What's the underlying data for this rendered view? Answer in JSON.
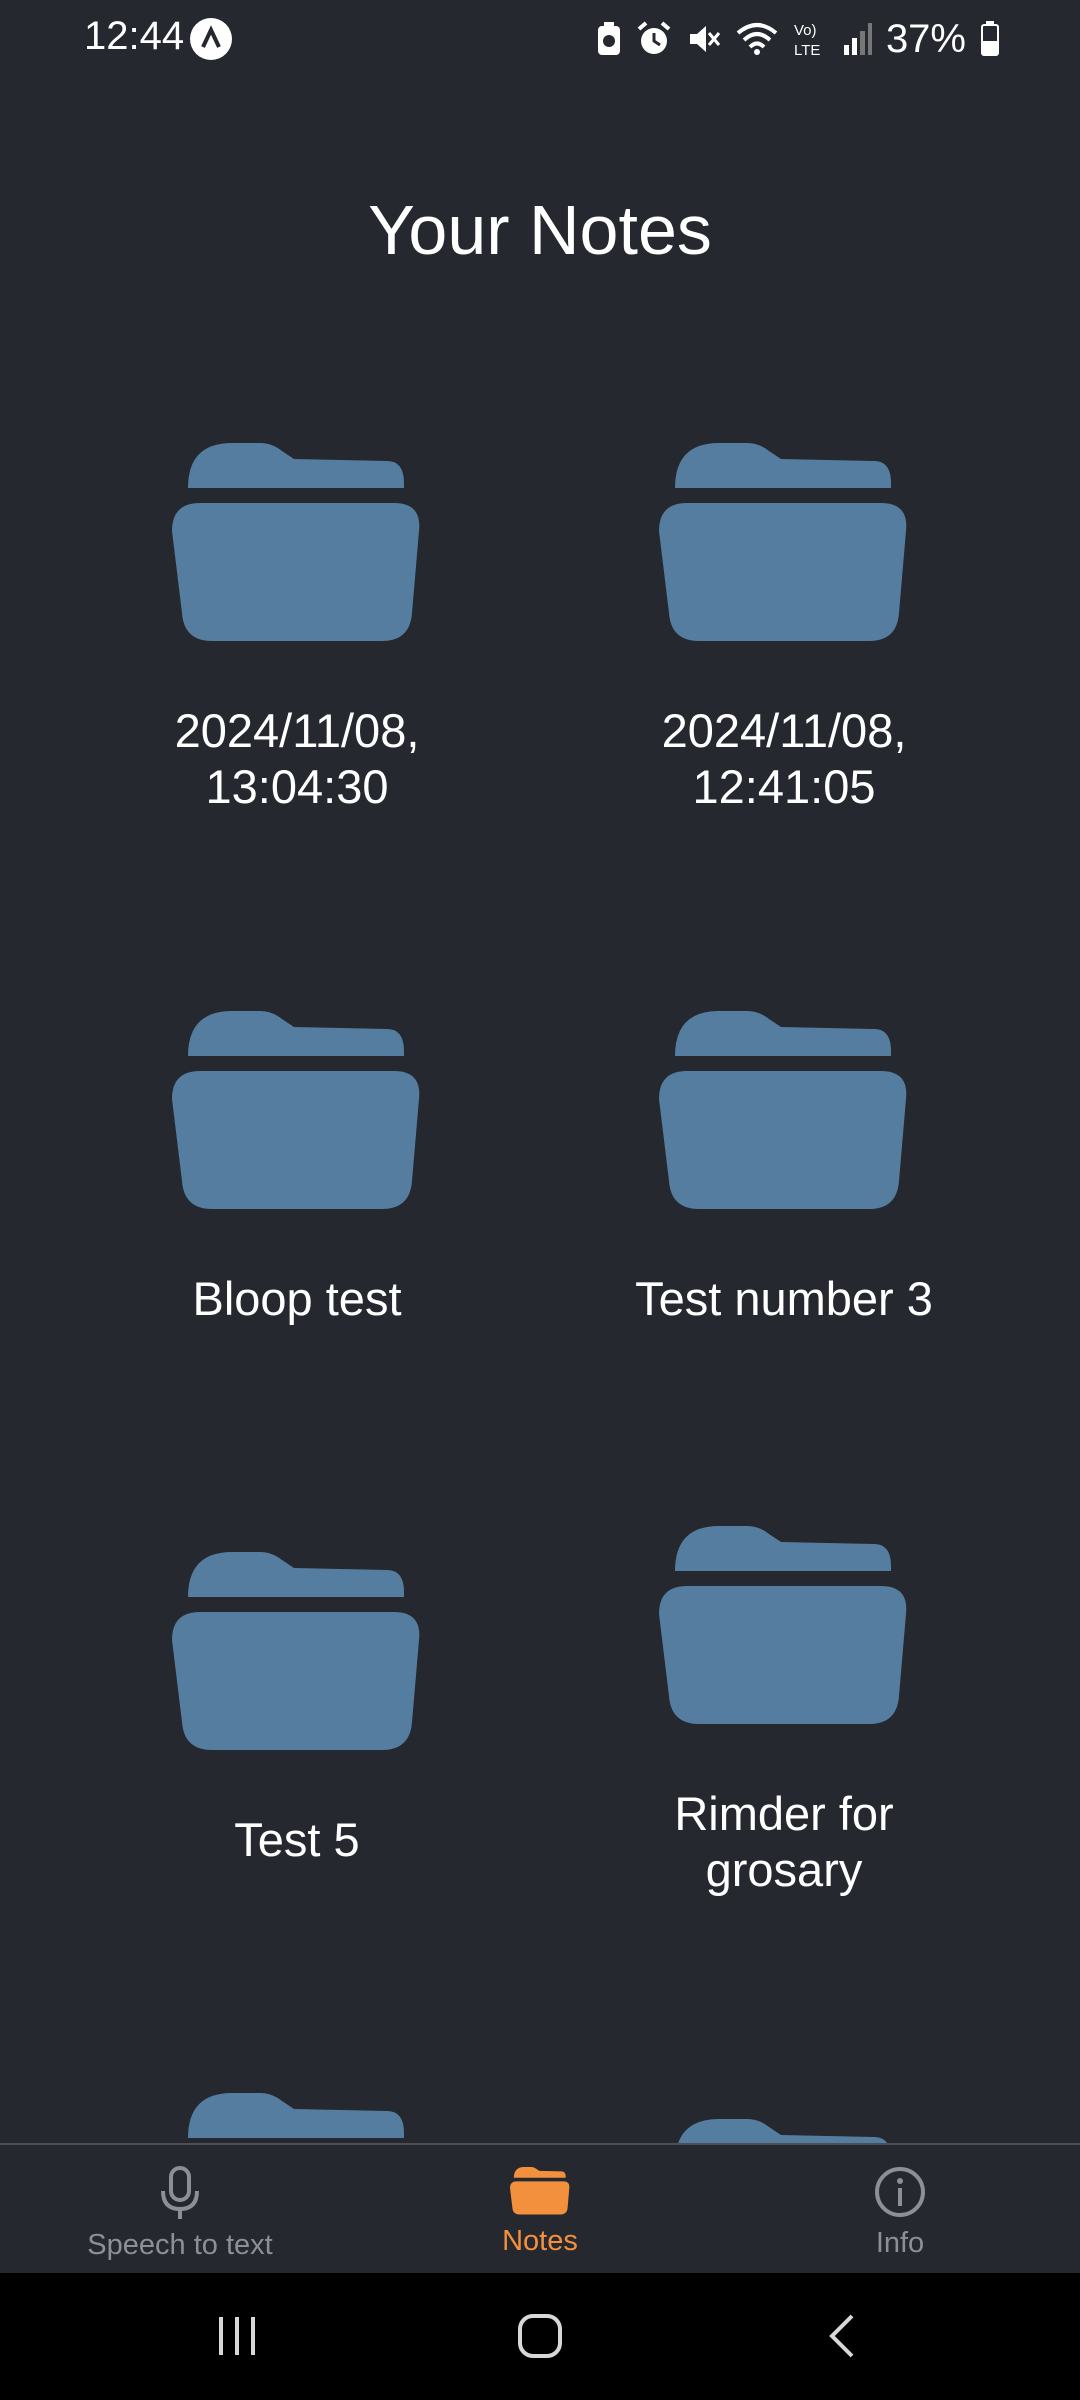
{
  "status_bar": {
    "time": "12:44",
    "battery": "37%",
    "network": "Vo) LTE"
  },
  "page": {
    "title": "Your Notes"
  },
  "notes": [
    {
      "label": "2024/11/08,\n13:04:30",
      "icon": "folder-icon"
    },
    {
      "label": "2024/11/08,\n12:41:05",
      "icon": "folder-icon"
    },
    {
      "label": "Bloop test",
      "icon": "folder-icon"
    },
    {
      "label": "Test number 3",
      "icon": "folder-icon"
    },
    {
      "label": "Test 5",
      "icon": "folder-icon"
    },
    {
      "label": "Rimder for\ngrosary",
      "icon": "folder-icon"
    }
  ],
  "bottom_nav": {
    "items": [
      {
        "label": "Speech to text",
        "icon": "microphone-icon"
      },
      {
        "label": "Notes",
        "icon": "folder-icon",
        "active": true
      },
      {
        "label": "Info",
        "icon": "info-icon"
      }
    ]
  },
  "colors": {
    "background": "#25282e",
    "folder": "#557d9f",
    "accent": "#f3903e",
    "inactive": "#8c8f95"
  },
  "system_nav": [
    "recent-apps",
    "home",
    "back"
  ]
}
